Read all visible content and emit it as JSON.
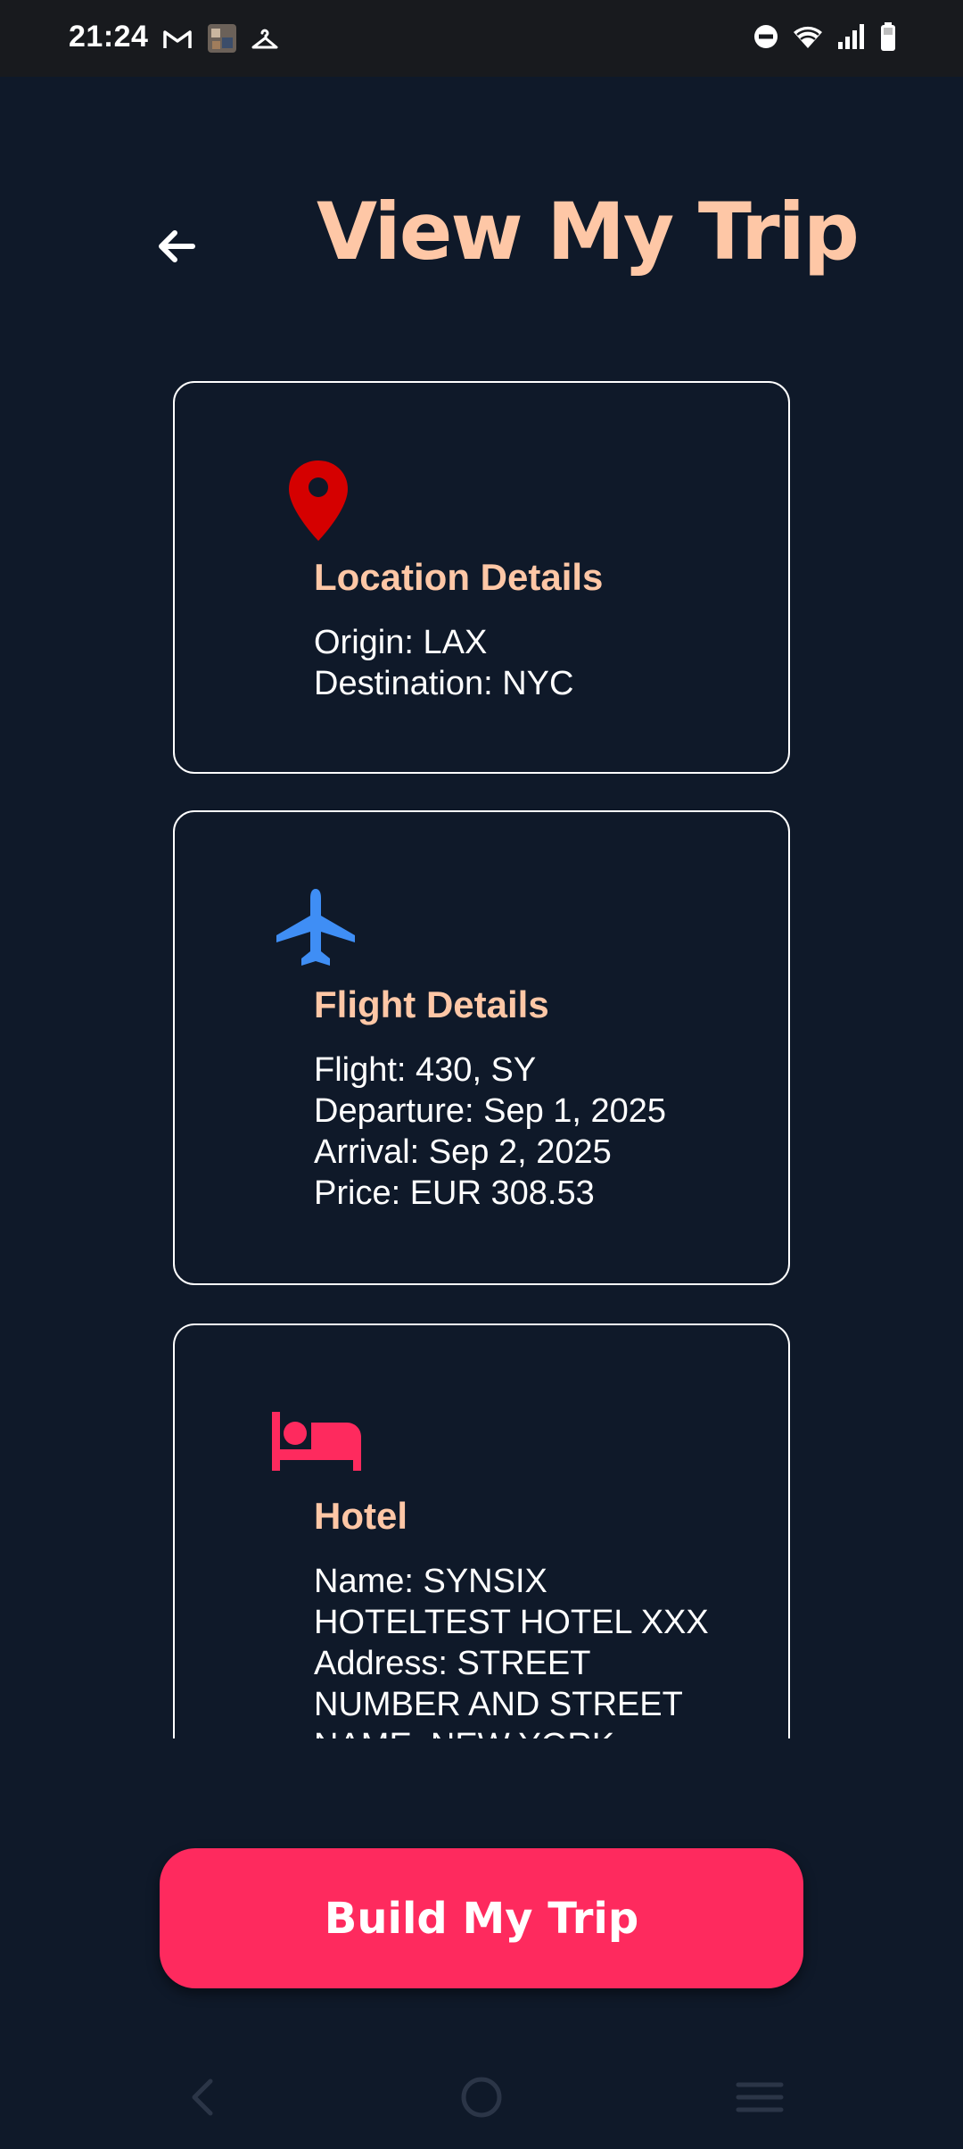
{
  "status_bar": {
    "time": "21:24",
    "left_icons": [
      "gmail-icon",
      "photo-thumbnail-icon",
      "hanger-icon"
    ],
    "right_icons": [
      "do-not-disturb-icon",
      "wifi-icon",
      "signal-icon",
      "battery-icon"
    ]
  },
  "header": {
    "back_icon": "arrow-left-icon",
    "title": "View My Trip"
  },
  "cards": {
    "location": {
      "icon": "location-pin-icon",
      "icon_color": "#d50000",
      "title": "Location Details",
      "lines": [
        "Origin: LAX",
        "Destination: NYC"
      ]
    },
    "flight": {
      "icon": "airplane-icon",
      "icon_color": "#3f8ef5",
      "title": "Flight Details",
      "lines": [
        "Flight: 430, SY",
        "Departure: Sep 1, 2025",
        "Arrival: Sep 2, 2025",
        "Price: EUR 308.53"
      ]
    },
    "hotel": {
      "icon": "bed-icon",
      "icon_color": "#fe2a5e",
      "title": "Hotel",
      "lines": [
        "Name: SYNSIX",
        "HOTELTEST HOTEL XXX",
        "Address: STREET",
        "NUMBER AND STREET",
        "NAME, NEW YORK"
      ]
    }
  },
  "actions": {
    "build_label": "Build My Trip"
  },
  "navigation": {
    "items": [
      "nav-back-icon",
      "nav-home-icon",
      "nav-recents-icon"
    ]
  },
  "colors": {
    "background": "#0f1929",
    "accent": "#fec7a6",
    "button": "#fe2a5e"
  }
}
